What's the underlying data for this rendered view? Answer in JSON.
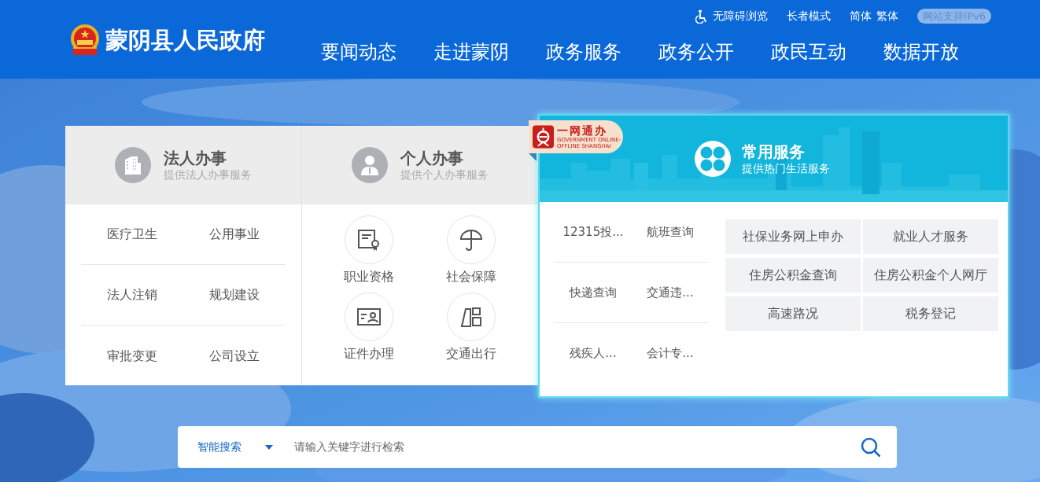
{
  "header": {
    "site_title": "蒙阴县人民政府",
    "top_links": [
      {
        "label": "无障碍浏览",
        "kind": "accessibility"
      },
      {
        "label": "长者模式",
        "kind": "text"
      },
      {
        "label": "简体",
        "kind": "text"
      },
      {
        "label": "繁体",
        "kind": "text"
      }
    ],
    "ipv6_badge": "网站支持IPv6",
    "nav": [
      "要闻动态",
      "走进蒙阴",
      "政务服务",
      "政务公开",
      "政民互动",
      "数据开放"
    ]
  },
  "panels": [
    {
      "title": "法人办事",
      "subtitle": "提供法人办事服务",
      "kind": "list",
      "items": [
        {
          "label": "医疗卫生"
        },
        {
          "label": "公用事业"
        },
        {
          "label": "法人注销"
        },
        {
          "label": "规划建设"
        },
        {
          "label": "审批变更"
        },
        {
          "label": "公司设立"
        }
      ]
    },
    {
      "title": "个人办事",
      "subtitle": "提供个人办事服务",
      "kind": "icons",
      "items": [
        {
          "label": "职业资格"
        },
        {
          "label": "社会保障"
        },
        {
          "label": "证件办理"
        },
        {
          "label": "交通出行"
        }
      ]
    }
  ],
  "common": {
    "badge": {
      "title": "一网通办",
      "subtitle": "GOVERNMENT ONLINE-OFFLINE SHANGHAI"
    },
    "title": "常用服务",
    "subtitle": "提供热门生活服务",
    "links": [
      "12315投...",
      "航班查询",
      "快递查询",
      "交通违...",
      "残疾人...",
      "会计专..."
    ],
    "tiles": [
      "社保业务网上申办",
      "就业人才服务",
      "住房公积金查询",
      "住房公积金个人网厅",
      "高速路况",
      "税务登记"
    ]
  },
  "search": {
    "scope": "智能搜索",
    "placeholder": "请输入关键字进行检索"
  }
}
